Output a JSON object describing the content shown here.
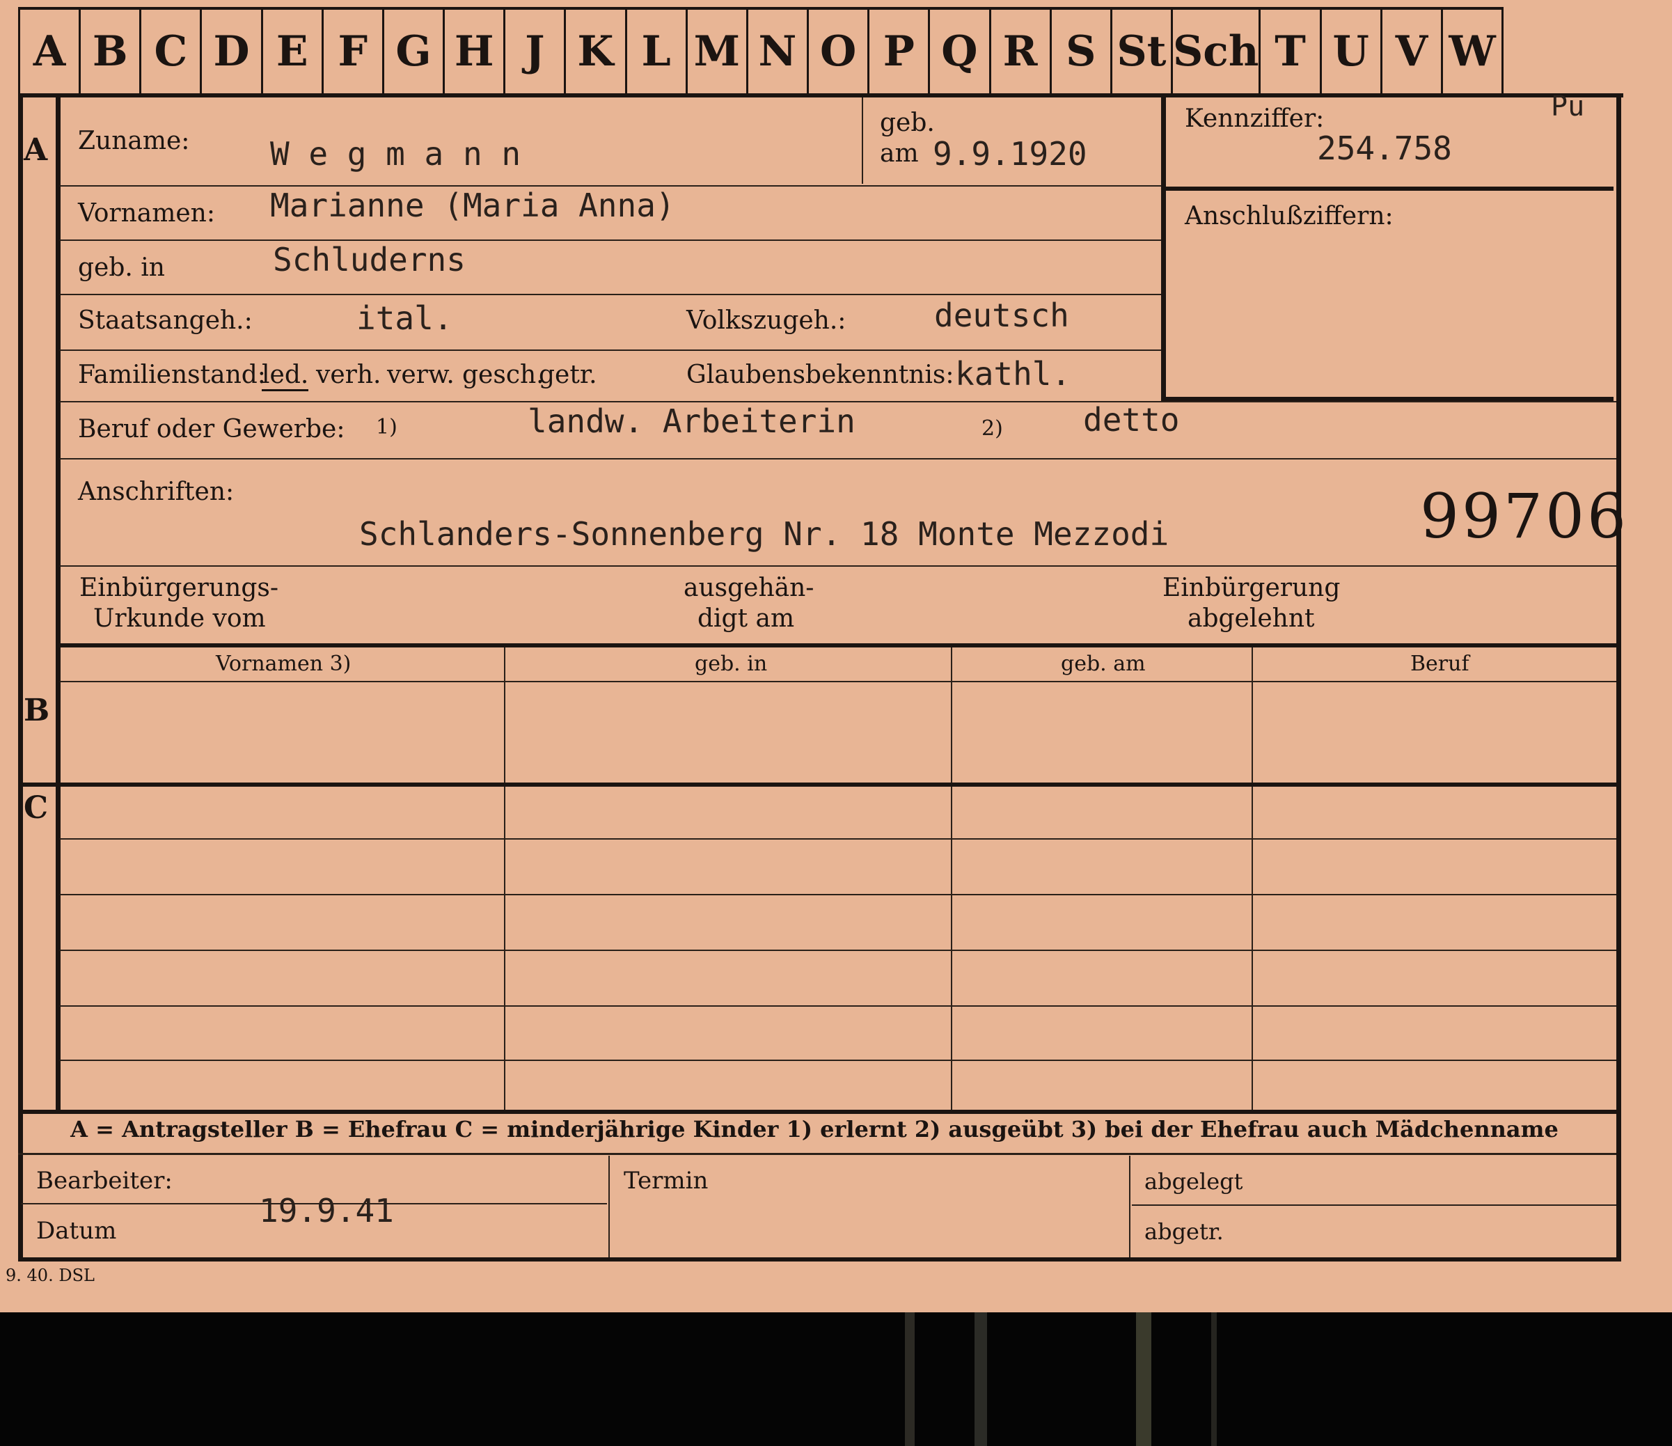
{
  "tabs": [
    "A",
    "B",
    "C",
    "D",
    "E",
    "F",
    "G",
    "H",
    "J",
    "K",
    "L",
    "M",
    "N",
    "O",
    "P",
    "Q",
    "R",
    "S",
    "St",
    "Sch",
    "T",
    "U",
    "V",
    "W"
  ],
  "sections": {
    "a": "A",
    "b": "B",
    "c": "C"
  },
  "labels": {
    "zuname": "Zuname:",
    "geb": "geb.",
    "am": "am",
    "kennziffer": "Kennziffer:",
    "anschlussziffern": "Anschlußziffern:",
    "vornamen": "Vornamen:",
    "geb_in": "geb. in",
    "staatsangeh": "Staatsangeh.:",
    "volkszugeh": "Volkszugeh.:",
    "familienstand": "Familienstand:",
    "familienstand_options": [
      "led.",
      "verh.",
      "verw.",
      "gesch.",
      "getr."
    ],
    "glaubensbekenntnis": "Glaubensbekenntnis:",
    "beruf": "Beruf oder Gewerbe:",
    "fn1": "1)",
    "fn2": "2)",
    "anschriften": "Anschriften:",
    "einbuergerungs_1": "Einbürgerungs-",
    "einbuergerungs_2": "Urkunde vom",
    "ausgehaen_1": "ausgehän-",
    "ausgehaen_2": "digt am",
    "abgelehnt_1": "Einbürgerung",
    "abgelehnt_2": "abgelehnt",
    "bearbeiter": "Bearbeiter:",
    "datum": "Datum",
    "termin": "Termin",
    "abgelegt": "abgelegt",
    "abgetr": "abgetr.",
    "print_code": "9. 40. DSL"
  },
  "table_headers": [
    "Vornamen 3)",
    "geb. in",
    "geb. am",
    "Beruf"
  ],
  "legend": "A = Antragsteller    B = Ehefrau    C = minderjährige Kinder    1) erlernt    2) ausgeübt    3) bei der Ehefrau auch Mädchenname",
  "values": {
    "zuname": "W e g m a n n",
    "geb_am": "9.9.1920",
    "marker": "Pu",
    "kennziffer": "254.758",
    "vornamen": "Marianne (Maria Anna)",
    "geb_in": "Schluderns",
    "staatsangeh": "ital.",
    "volkszugeh": "deutsch",
    "glaube": "kathl.",
    "beruf_1": "landw. Arbeiterin",
    "beruf_2": "detto",
    "anschrift": "Schlanders-Sonnenberg Nr. 18 Monte Mezzodi",
    "stamp_number": "99706",
    "datum": "19.9.41"
  }
}
